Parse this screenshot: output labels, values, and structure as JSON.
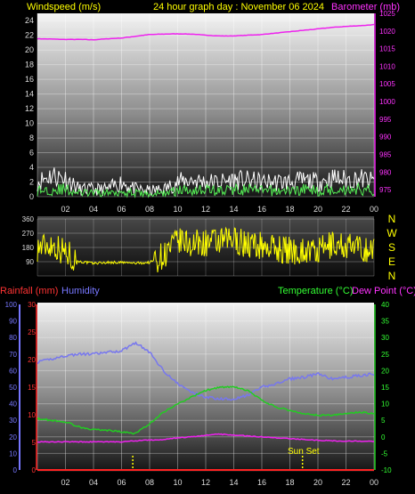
{
  "header": {
    "left_label": "Windspeed (m/s)",
    "center_label": "24 hour graph day : November 06 2024",
    "right_label": "Barometer (mb)"
  },
  "colors": {
    "gust": "#ffffff",
    "wind": "#55ee55",
    "barometer": "#ee22ee",
    "direction": "#ffff00",
    "temperature": "#22cc22",
    "humidity": "#7777ee",
    "dewpoint": "#ee22ee",
    "rain": "#ff2222",
    "label_yellow": "#ffff00",
    "label_red": "#ff3333",
    "label_green": "#33ff33",
    "label_blue": "#7777ff",
    "label_magenta": "#ff33ff"
  },
  "compass_letters": [
    "N",
    "W",
    "S",
    "E",
    "N"
  ],
  "panel3_labels": {
    "rain": "Rainfall (mm)",
    "humidity": "Humidity",
    "temperature": "Temperature (°C)",
    "dewpoint": "Dew Point (°C)",
    "sunset": "Sun Set"
  },
  "chart_data": [
    {
      "type": "line",
      "ylabel_left": "Windspeed (m/s)",
      "ylabel_right": "Barometer (mb)",
      "x_ticks": [
        "02",
        "04",
        "06",
        "08",
        "10",
        "12",
        "14",
        "16",
        "18",
        "20",
        "22",
        "00"
      ],
      "x_hours": [
        0,
        1,
        2,
        3,
        4,
        5,
        6,
        7,
        8,
        9,
        10,
        11,
        12,
        13,
        14,
        15,
        16,
        17,
        18,
        19,
        20,
        21,
        22,
        23,
        24
      ],
      "ylim_left": [
        0,
        25
      ],
      "yticks_left": [
        0,
        2,
        4,
        6,
        8,
        10,
        12,
        14,
        16,
        18,
        20,
        22,
        24
      ],
      "ylim_right": [
        973,
        1025
      ],
      "yticks_right": [
        975,
        980,
        985,
        990,
        995,
        1000,
        1005,
        1010,
        1015,
        1020,
        1025
      ],
      "grid": true,
      "series": [
        {
          "name": "Barometer",
          "axis": "right",
          "values": [
            1017.8,
            1017.7,
            1017.6,
            1017.6,
            1017.5,
            1017.8,
            1018.0,
            1018.5,
            1019.0,
            1019.1,
            1019.2,
            1019.1,
            1018.8,
            1018.6,
            1018.6,
            1018.8,
            1019.0,
            1019.4,
            1019.8,
            1020.2,
            1020.6,
            1021.0,
            1021.3,
            1021.5,
            1021.8
          ]
        },
        {
          "name": "Gust",
          "axis": "left",
          "values": [
            2.0,
            3.0,
            2.5,
            1.0,
            1.0,
            1.0,
            2.0,
            1.0,
            0.8,
            1.0,
            2.0,
            2.3,
            2.0,
            2.0,
            2.3,
            2.2,
            2.0,
            2.0,
            2.0,
            2.2,
            2.0,
            2.5,
            2.3,
            2.5,
            2.0
          ]
        },
        {
          "name": "Wind",
          "axis": "left",
          "values": [
            0.8,
            1.0,
            1.0,
            0.5,
            0.5,
            0.5,
            0.8,
            0.5,
            0.3,
            0.5,
            0.8,
            1.0,
            1.0,
            0.8,
            1.0,
            1.0,
            0.8,
            0.8,
            0.8,
            1.0,
            0.8,
            1.0,
            1.0,
            1.0,
            0.8
          ]
        }
      ]
    },
    {
      "type": "line",
      "ylim": [
        0,
        360
      ],
      "yticks": [
        0,
        90,
        180,
        270,
        360
      ],
      "series": [
        {
          "name": "Wind Direction",
          "values": [
            180,
            200,
            150,
            90,
            80,
            85,
            85,
            80,
            85,
            130,
            220,
            200,
            210,
            210,
            230,
            200,
            190,
            175,
            160,
            160,
            150,
            200,
            190,
            170,
            160
          ]
        }
      ]
    },
    {
      "type": "line",
      "x_ticks": [
        "02",
        "04",
        "06",
        "08",
        "10",
        "12",
        "14",
        "16",
        "18",
        "20",
        "22",
        "00"
      ],
      "ylim_humidity": [
        0,
        100
      ],
      "yticks_humidity": [
        0,
        10,
        20,
        30,
        40,
        50,
        60,
        70,
        80,
        90,
        100
      ],
      "ylim_rain": [
        0,
        30
      ],
      "yticks_rain": [
        0,
        5,
        10,
        15,
        20,
        25,
        30
      ],
      "ylim_temp": [
        -10,
        40
      ],
      "yticks_temp": [
        -10,
        -5,
        0,
        5,
        10,
        15,
        20,
        25,
        30,
        35,
        40
      ],
      "sunrise_hour": 6.8,
      "sunset_hour": 18.9,
      "series": [
        {
          "name": "Humidity",
          "axis": "humidity",
          "values": [
            65,
            67,
            69,
            70,
            70,
            71,
            72,
            77,
            71,
            60,
            52,
            47,
            44,
            43,
            43,
            45,
            50,
            52,
            55,
            56,
            58,
            55,
            56,
            57,
            58
          ]
        },
        {
          "name": "Temperature",
          "axis": "temp",
          "values": [
            5.5,
            5.0,
            4.5,
            3.0,
            2.2,
            2.0,
            1.5,
            1.0,
            4.0,
            7.5,
            10.0,
            12.0,
            14.0,
            15.0,
            15.0,
            14.0,
            11.0,
            9.0,
            8.0,
            7.0,
            6.5,
            6.5,
            7.0,
            7.5,
            7.0
          ]
        },
        {
          "name": "Dew Point",
          "axis": "temp",
          "values": [
            -1.5,
            -1.5,
            -1.5,
            -1.5,
            -1.5,
            -1.5,
            -1.5,
            -1.2,
            -1.0,
            -0.8,
            -0.3,
            0.0,
            0.5,
            0.8,
            0.5,
            0.3,
            0.0,
            -0.3,
            -0.5,
            -0.8,
            -1.0,
            -1.2,
            -1.3,
            -1.3,
            -1.3
          ]
        },
        {
          "name": "Rainfall",
          "axis": "rain",
          "values": [
            0,
            0,
            0,
            0,
            0,
            0,
            0,
            0,
            0,
            0,
            0,
            0,
            0,
            0,
            0,
            0,
            0,
            0,
            0,
            0,
            0,
            0,
            0,
            0,
            0
          ]
        }
      ]
    }
  ]
}
